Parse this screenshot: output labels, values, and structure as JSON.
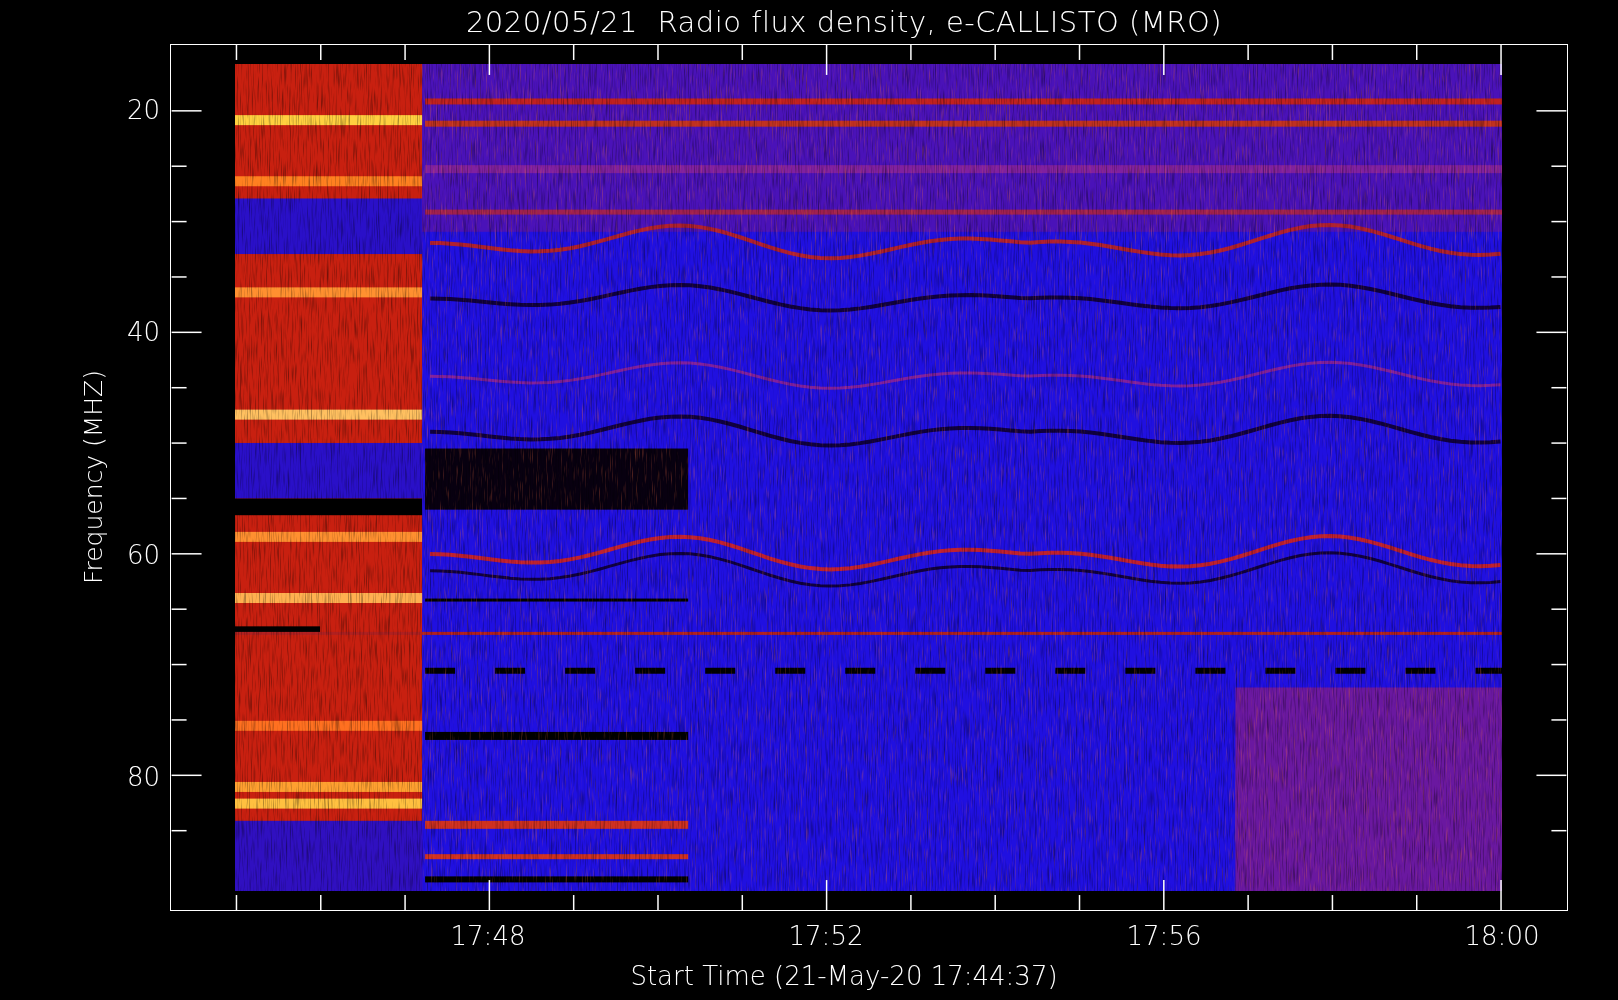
{
  "title": "2020/05/21  Radio flux density, e-CALLISTO (MRO)",
  "y_axis": {
    "label": "Frequency (MHZ)",
    "tick_labels": [
      "20",
      "40",
      "60",
      "80"
    ]
  },
  "x_axis": {
    "label": "Start Time (21-May-20 17:44:37)",
    "tick_labels": [
      "17:48",
      "17:52",
      "17:56",
      "18:00"
    ]
  }
}
